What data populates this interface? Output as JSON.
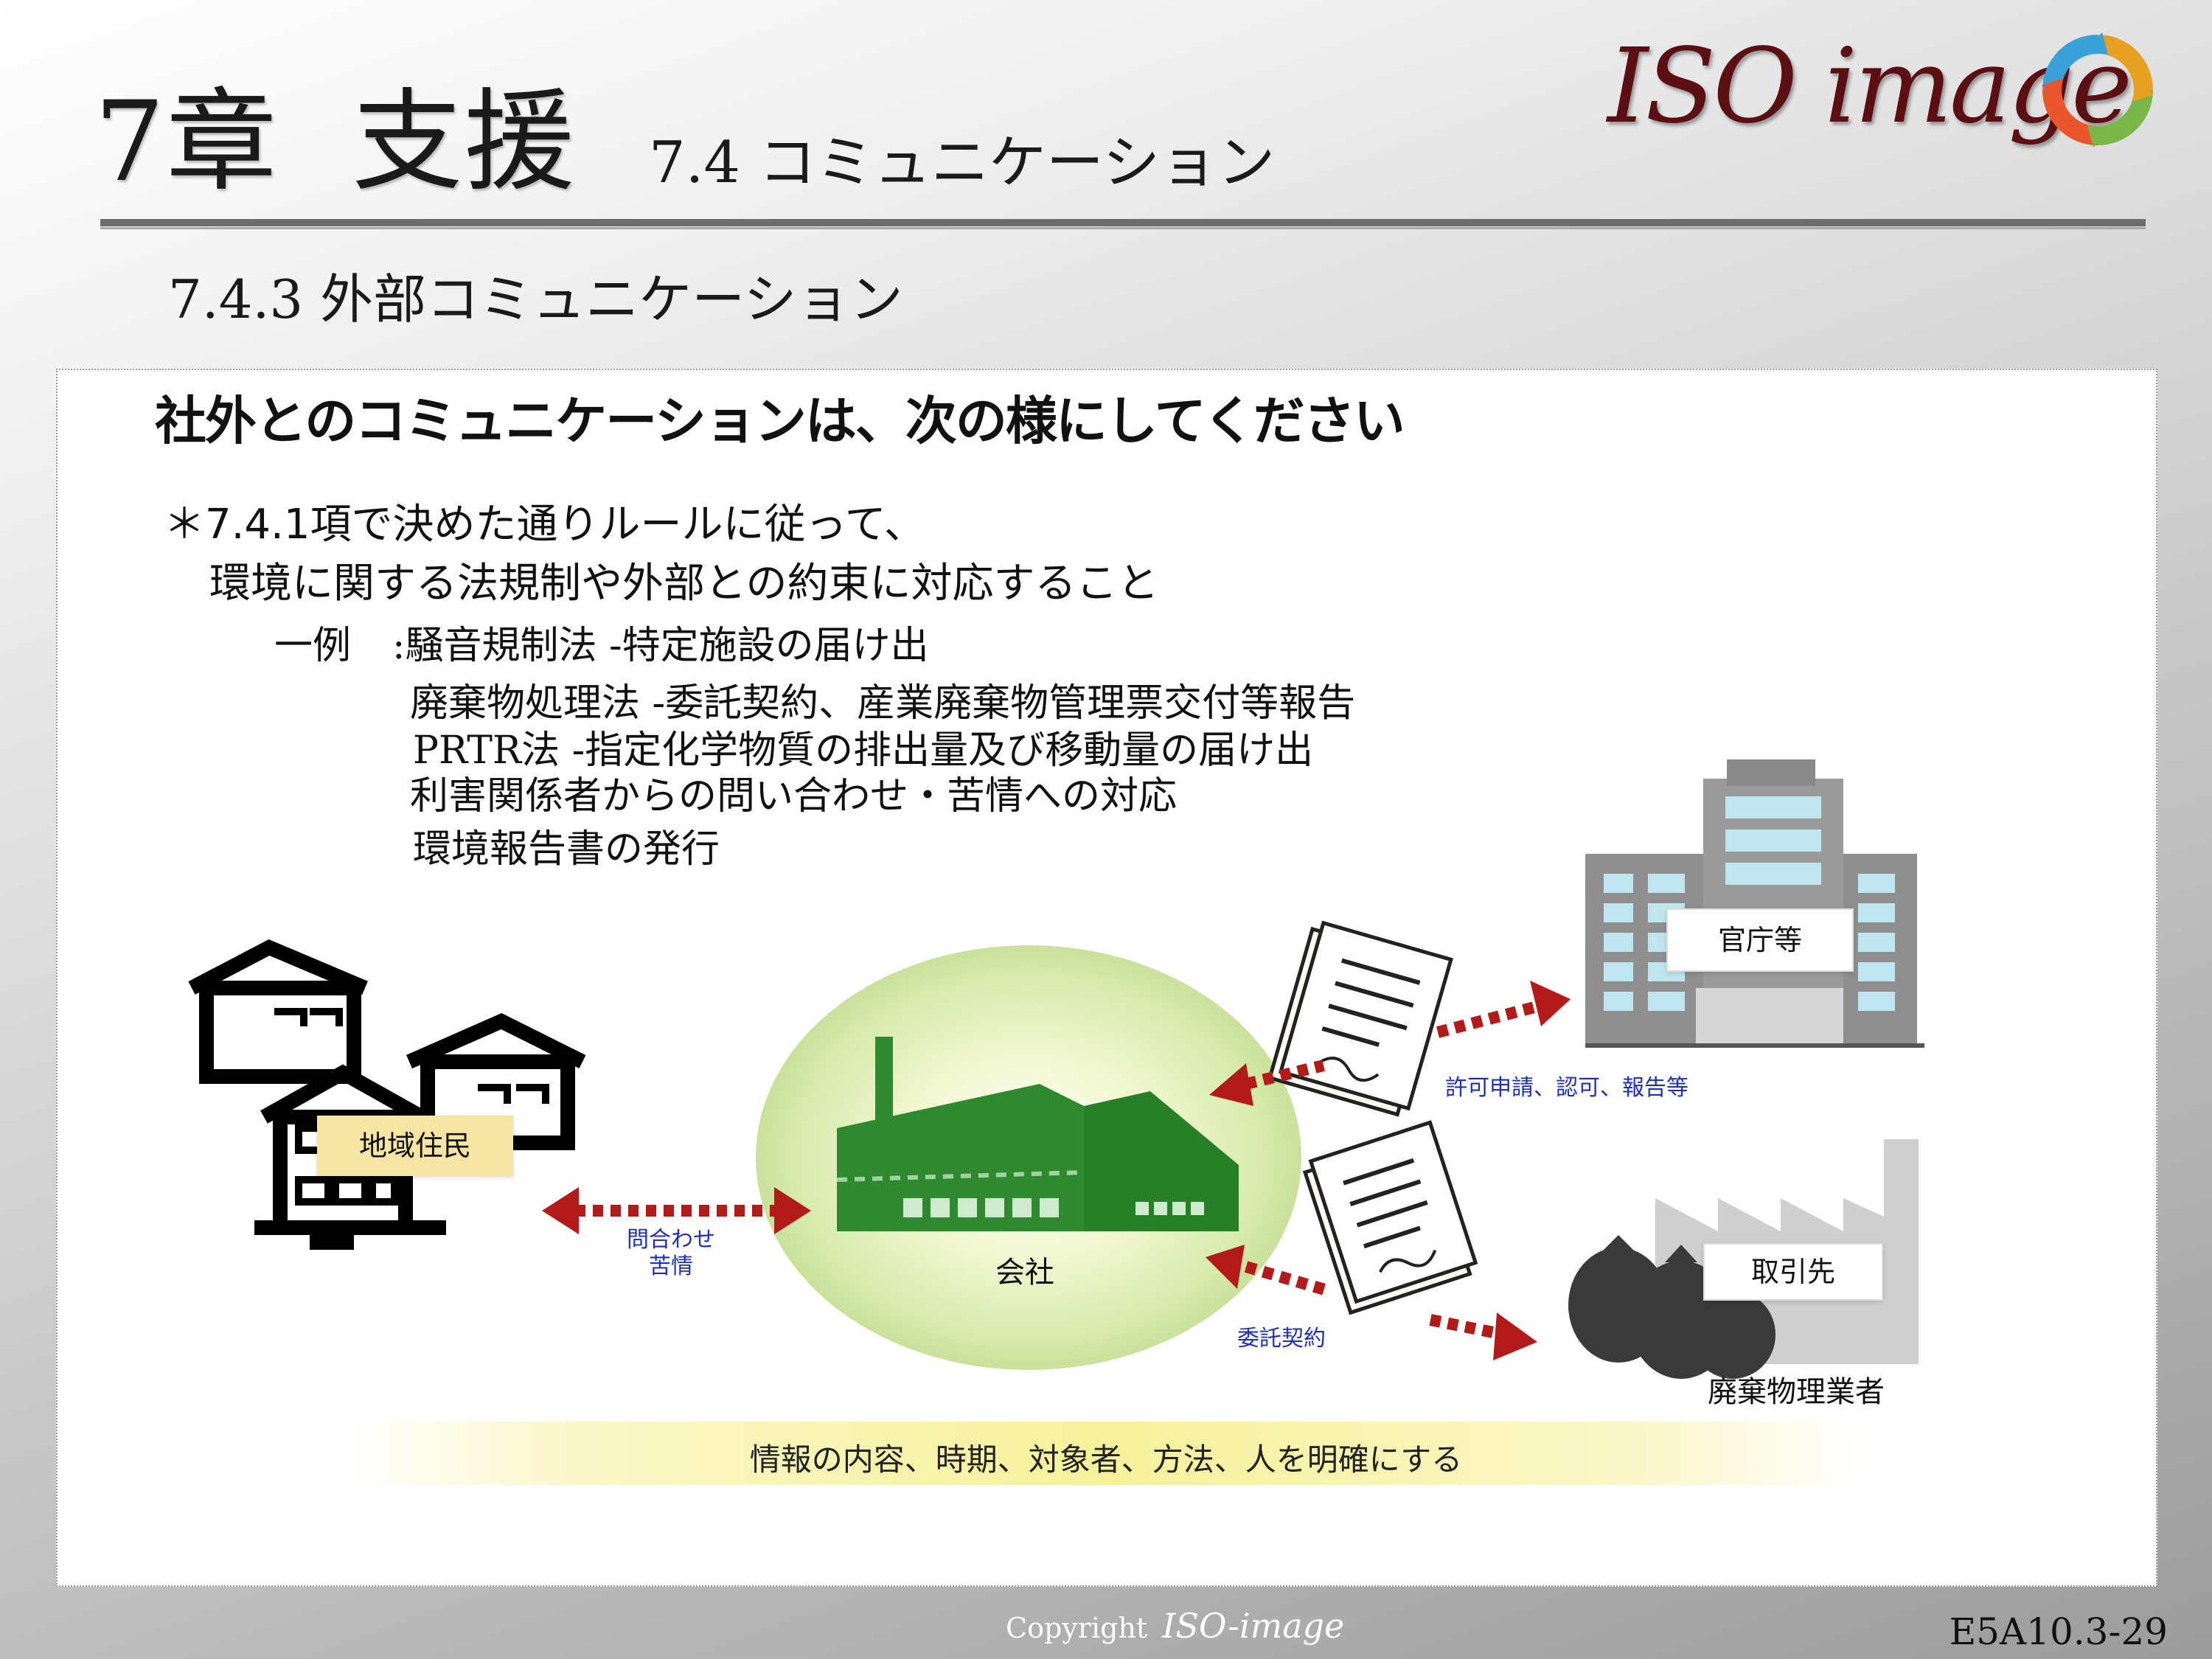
{
  "header": {
    "chapter_number": "7章",
    "chapter_title": "支援",
    "section": "7.4 コミュニケーション",
    "subsection": "7.4.3 外部コミュニケーション"
  },
  "logo": {
    "text": "ISO image"
  },
  "content": {
    "headline": "社外とのコミュニケーションは、次の様にしてください",
    "bullet_line1": "＊7.4.1項で決めた通りルールに従って、",
    "bullet_line2": "環境に関する法規制や外部との約束に対応すること",
    "example_label": "一例",
    "examples": [
      ":騒音規制法 -特定施設の届け出",
      "廃棄物処理法 -委託契約、産業廃棄物管理票交付等報告",
      "PRTR法 -指定化学物質の排出量及び移動量の届け出",
      "利害関係者からの問い合わせ・苦情への対応",
      "環境報告書の発行"
    ]
  },
  "diagram": {
    "residents_label": "地域住民",
    "company_label": "会社",
    "government_label": "官庁等",
    "partner_label": "取引先",
    "waste_caption": "廃棄物理業者",
    "resident_link_lines": [
      "問合わせ",
      "苦情"
    ],
    "government_link": "許可申請、認可、報告等",
    "partner_link": "委託契約",
    "banner": "情報の内容、時期、対象者、方法、人を明確にする"
  },
  "footer": {
    "copyright": "Copyright",
    "brand": "ISO-image",
    "page_number": "E5A10.3-29"
  },
  "colors": {
    "logo": "#5b0f12",
    "arrow": "#b31b1b",
    "factory": "#2f8a2f",
    "link_text": "#1f2fb8",
    "label_fill": "#f7e6a3"
  }
}
